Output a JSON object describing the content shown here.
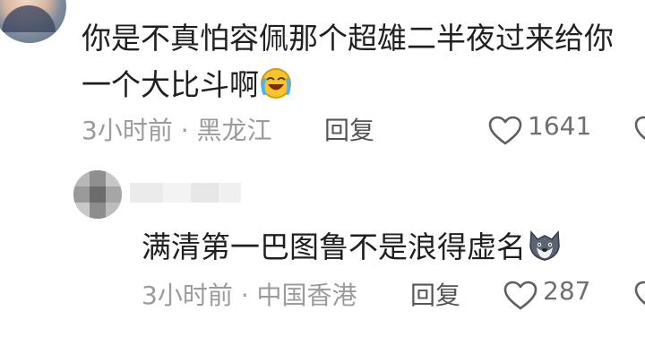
{
  "comment": {
    "line1": "你是不真怕容佩那个超雄二半夜过来给你",
    "line2": "一个大比斗啊",
    "emoji_icon": "laughing-crying-icon",
    "time_location": "3小时前 · 黑龙江",
    "reply_label": "回复",
    "like_count": "1641"
  },
  "reply": {
    "text": "满清第一巴图鲁不是浪得虚名",
    "emoji_icon": "wolf-face-icon",
    "time_location": "3小时前 · 中国香港",
    "reply_label": "回复",
    "like_count": "287"
  },
  "colors": {
    "text": "#1f1f1f",
    "meta": "#9b9b9b",
    "reply_action": "#555555",
    "like_count": "#6f6f6f"
  }
}
